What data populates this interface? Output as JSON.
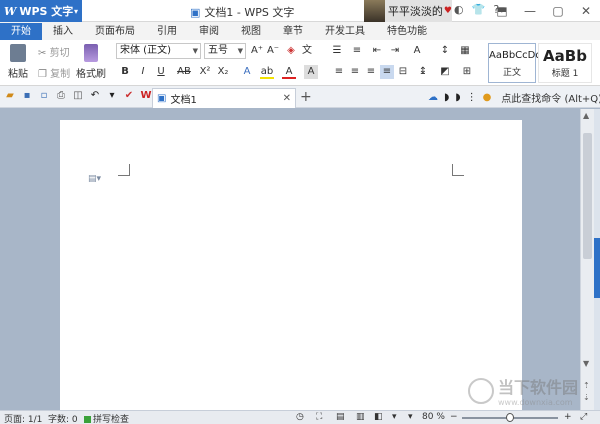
{
  "app": {
    "name": "WPS 文字",
    "window_title": "文档1 - WPS 文字",
    "user_name": "平平淡淡的",
    "accent": "#2e71c7"
  },
  "tabs": [
    "开始",
    "插入",
    "页面布局",
    "引用",
    "审阅",
    "视图",
    "章节",
    "开发工具",
    "特色功能"
  ],
  "ribbon": {
    "paste": "粘贴",
    "cut": "剪切",
    "copy": "复制",
    "format_painter": "格式刷",
    "font_name": "宋体 (正文)",
    "font_size": "五号",
    "styles": [
      {
        "preview": "AaBbCcDd",
        "name": "正文"
      },
      {
        "preview": "AaBb",
        "name": "标题 1"
      }
    ]
  },
  "doc_tab": {
    "title": "文档1"
  },
  "search_command": "点此查找命令 (Alt+Q)",
  "watermark": {
    "title": "当下软件园",
    "url": "www.downxia.com"
  },
  "status": {
    "page": "页面: 1/1",
    "words": "字数: 0",
    "spell": "拼写检查",
    "zoom": "80 %",
    "zoom_level": 0.5
  }
}
